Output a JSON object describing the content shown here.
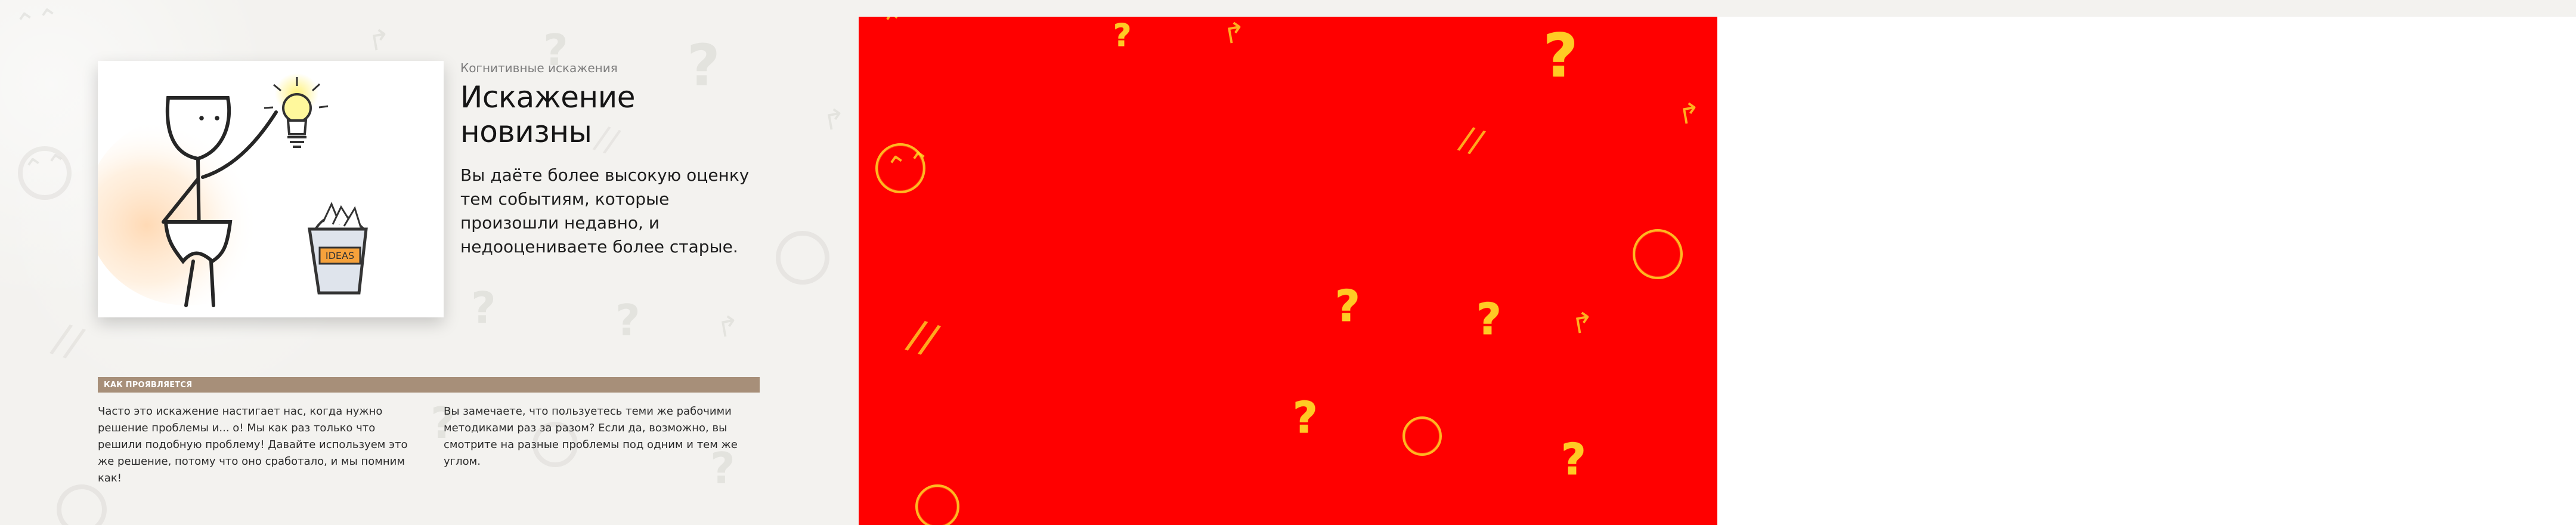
{
  "article": {
    "category": "Когнитивные искажения",
    "title": "Искажение новизны",
    "lead": "Вы даёте более высокую оценку тем событиям, которые произошли недавно, и недооцениваете более старые."
  },
  "section": {
    "title": "КАК ПРОЯВЛЯЕТСЯ",
    "columns": [
      "Часто это искажение настигает нас, когда нужно решение проблемы и... о! Мы как раз только что решили подобную проблему! Давайте используем это же решение, потому что оно сработало, и мы помним как!",
      "Вы замечаете, что пользуетесь теми же рабочими методиками раз за разом? Если да, возможно, вы смотрите на разные проблемы под одним и тем же углом."
    ]
  },
  "illustration": {
    "basket_label": "IDEAS"
  },
  "colors": {
    "background": "#f3f2ef",
    "accent_bar": "#a78f79",
    "mask_red": "#ff0000",
    "mask_yellow": "#ffdc14"
  }
}
